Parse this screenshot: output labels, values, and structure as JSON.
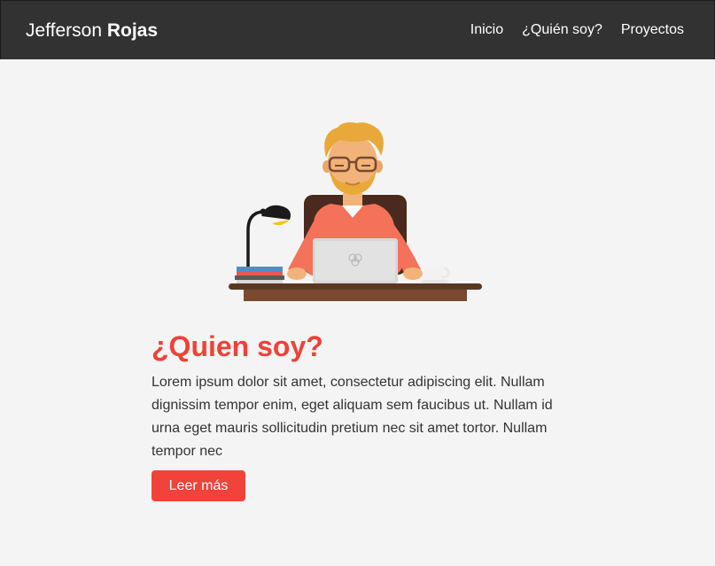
{
  "header": {
    "brand_first": "Jefferson",
    "brand_last": "Rojas",
    "nav": [
      "Inicio",
      "¿Quién soy?",
      "Proyectos"
    ]
  },
  "about": {
    "title": "¿Quien soy?",
    "text": "Lorem ipsum dolor sit amet, consectetur adipiscing elit. Nullam dignissim tempor enim, eget aliquam sem faucibus ut. Nullam id urna eget mauris sollicitudin pretium nec sit amet tortor. Nullam tempor nec",
    "button_label": "Leer más"
  },
  "colors": {
    "navbar": "#323232",
    "accent": "#ef4236",
    "background": "#f4f4f4",
    "text": "#333333"
  },
  "icons": {
    "illustration": "developer-at-desk-illustration"
  }
}
